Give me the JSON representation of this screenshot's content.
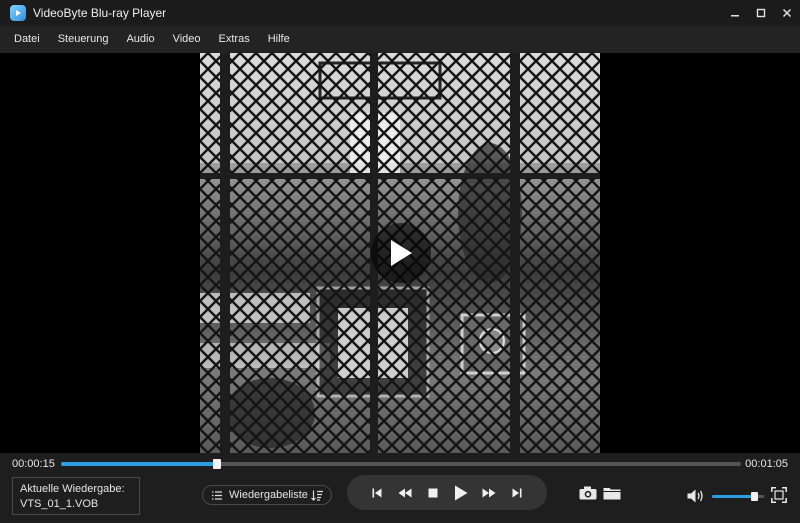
{
  "window": {
    "title": "VideoByte Blu-ray Player",
    "controls": [
      "minimize-icon",
      "maximize-icon",
      "close-icon"
    ]
  },
  "menu": {
    "items": [
      "Datei",
      "Steuerung",
      "Audio",
      "Video",
      "Extras",
      "Hilfe"
    ]
  },
  "player": {
    "current_time": "00:00:15",
    "total_time": "00:01:05",
    "progress_fraction": 0.23,
    "volume_fraction": 0.8,
    "state": "paused",
    "accent_color": "#2a9fe0"
  },
  "now_playing": {
    "label": "Aktuelle Wiedergabe:",
    "file": "VTS_01_1.VOB"
  },
  "playlist": {
    "label": "Wiedergabeliste"
  },
  "icons": {
    "transport": [
      "skip-previous-icon",
      "rewind-icon",
      "stop-icon",
      "play-icon",
      "fast-forward-icon",
      "skip-next-icon"
    ],
    "tools": [
      "camera-icon",
      "folder-icon",
      "volume-icon",
      "fullscreen-icon"
    ]
  }
}
